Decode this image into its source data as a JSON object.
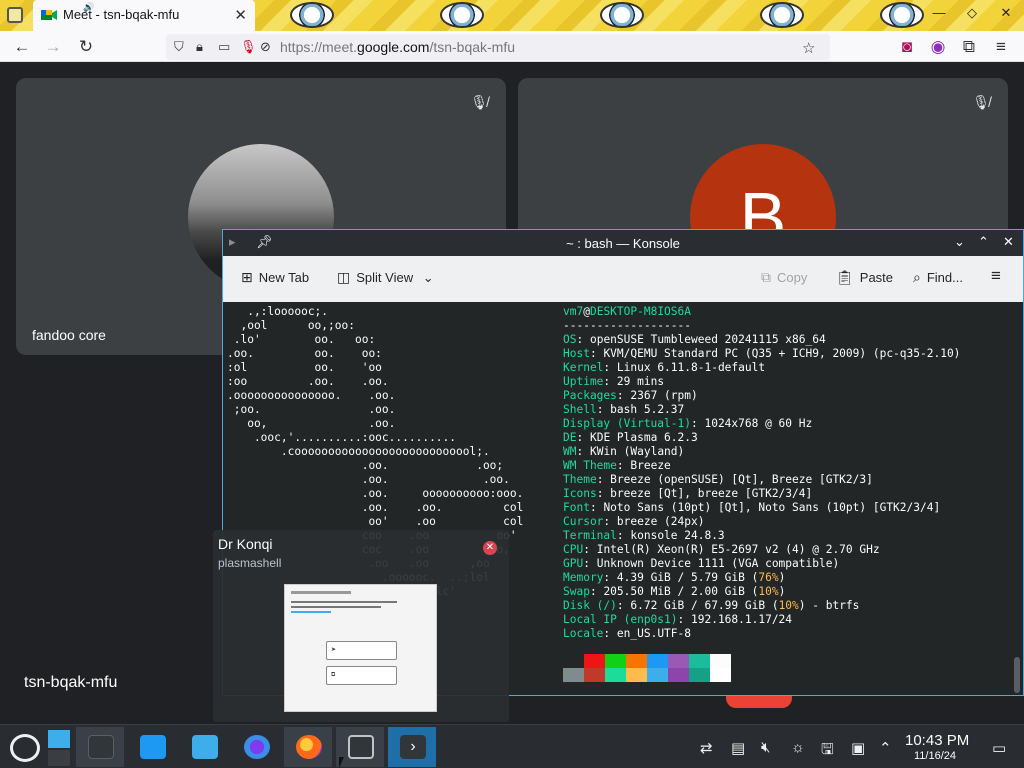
{
  "browser": {
    "tab_title": "Meet - tsn-bqak-mfu",
    "tab_close": "✕",
    "url_prefix": "https://meet.",
    "url_domain": "google.com",
    "url_path": "/tsn-bqak-mfu"
  },
  "meet": {
    "participant_left_name": "fandoo core",
    "participant_right_initial": "B",
    "meeting_code": "tsn-bqak-mfu"
  },
  "konsole": {
    "title": "~ : bash — Konsole",
    "toolbar": {
      "new_tab": "New Tab",
      "split_view": "Split View",
      "copy": "Copy",
      "paste": "Paste",
      "find": "Find..."
    },
    "logo": "   .,:loooooc;.\n  ,ool      oo,;oo:\n .lo'        oo.   oo:\n.oo.         oo.    oo:\n:ol          oo.    'oo\n:oo         .oo.    .oo.\n.ooooooooooooooo.    .oo.\n ;oo.                .oo.\n   oo,               .oo.\n    .ooc,'..........:ooc..........\n        .cooooooooooooooooooooooooool;.\n                    .oo.             .oo;\n                    .oo.              .oo.\n                    .oo.     oooooooooo:ooo.\n                    .oo.    .oo.         col\n                     oo'    .oo          col\n                    coo    .oo          oo'\n                    coc    .oo        ,lo,\n                     .oo   .oo      ,oo\n                       .oooooc.  ..;lol\n                           '..clc'",
    "user": "vm7",
    "host": "DESKTOP-M8IOS6A",
    "separator": "-------------------",
    "info": [
      {
        "key": "OS",
        "value": "openSUSE Tumbleweed 20241115 x86_64"
      },
      {
        "key": "Host",
        "value": "KVM/QEMU Standard PC (Q35 + ICH9, 2009) (pc-q35-2.10)"
      },
      {
        "key": "Kernel",
        "value": "Linux 6.11.8-1-default"
      },
      {
        "key": "Uptime",
        "value": "29 mins"
      },
      {
        "key": "Packages",
        "value": "2367 (rpm)"
      },
      {
        "key": "Shell",
        "value": "bash 5.2.37"
      },
      {
        "key": "Display (Virtual-1)",
        "value": "1024x768 @ 60 Hz"
      },
      {
        "key": "DE",
        "value": "KDE Plasma 6.2.3"
      },
      {
        "key": "WM",
        "value": "KWin (Wayland)"
      },
      {
        "key": "WM Theme",
        "value": "Breeze"
      },
      {
        "key": "Theme",
        "value": "Breeze (openSUSE) [Qt], Breeze [GTK2/3]"
      },
      {
        "key": "Icons",
        "value": "breeze [Qt], breeze [GTK2/3/4]"
      },
      {
        "key": "Font",
        "value": "Noto Sans (10pt) [Qt], Noto Sans (10pt) [GTK2/3/4]"
      },
      {
        "key": "Cursor",
        "value": "breeze (24px)"
      },
      {
        "key": "Terminal",
        "value": "konsole 24.8.3"
      },
      {
        "key": "CPU",
        "value": "Intel(R) Xeon(R) E5-2697 v2 (4) @ 2.70 GHz"
      },
      {
        "key": "GPU",
        "value": "Unknown Device 1111 (VGA compatible)"
      }
    ],
    "memory": {
      "key": "Memory",
      "value": "4.39 GiB / 5.79 GiB (",
      "pct": "76%",
      "end": ")"
    },
    "swap": {
      "key": "Swap",
      "value": "205.50 MiB / 2.00 GiB (",
      "pct": "10%",
      "end": ")"
    },
    "disk": {
      "key": "Disk (/)",
      "value": "6.72 GiB / 67.99 GiB (",
      "pct": "10%",
      "end": ") - btrfs"
    },
    "local_ip": {
      "key": "Local IP (enp0s1)",
      "value": "192.168.1.17/24"
    },
    "locale": {
      "key": "Locale",
      "value": "en_US.UTF-8"
    },
    "swatch_colors_top": [
      "#232627",
      "#ed1515",
      "#11d116",
      "#f67400",
      "#1d99f3",
      "#9b59b6",
      "#1abc9c",
      "#fcfcfc"
    ],
    "swatch_colors_bottom": [
      "#7f8c8d",
      "#c0392b",
      "#1cdc9a",
      "#fdbc4b",
      "#3daee9",
      "#8e44ad",
      "#16a085",
      "#ffffff"
    ]
  },
  "konqi": {
    "title": "Dr Konqi",
    "subtitle": "plasmashell",
    "close": "✕"
  },
  "taskbar": {
    "time": "10:43 PM",
    "date": "11/16/24"
  }
}
